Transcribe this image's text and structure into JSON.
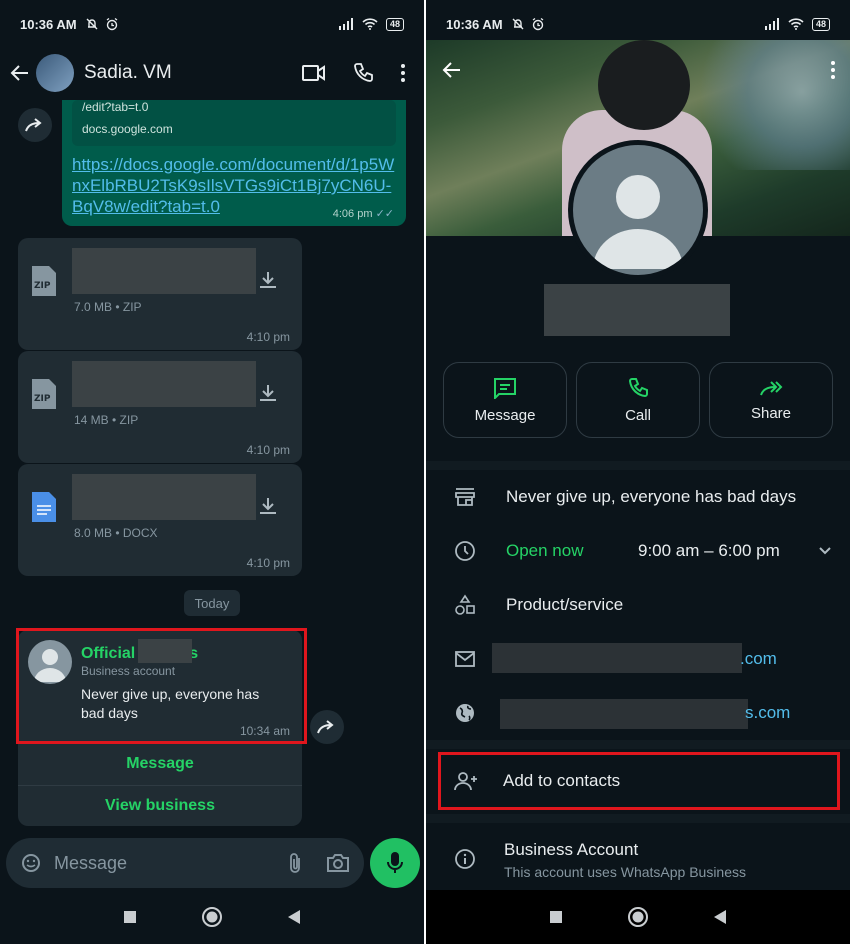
{
  "left": {
    "status": {
      "time": "10:36 AM",
      "battery": "48"
    },
    "header": {
      "back": "←",
      "name": "Sadia. VM"
    },
    "link_message": {
      "preview_line1": "/edit?tab=t.0",
      "preview_domain": "docs.google.com",
      "url": "https://docs.google.com/document/d/1p5WnxElbRBU2TsK9sIlsVTGs9iCt1Bj7yCN6U-BqV8w/edit?tab=t.0",
      "time": "4:06 pm",
      "ticks": "✓✓"
    },
    "files": [
      {
        "meta": "7.0 MB • ZIP",
        "time": "4:10 pm",
        "type_label": "ZIP"
      },
      {
        "meta": "14 MB • ZIP",
        "time": "4:10 pm",
        "type_label": "ZIP"
      },
      {
        "meta": "8.0 MB • DOCX",
        "time": "4:10 pm",
        "type_label": ""
      }
    ],
    "date_chip": "Today",
    "contact_card": {
      "name": "Official",
      "name_suffix": "s",
      "subtitle": "Business account",
      "about": "Never give up, everyone has bad days",
      "time": "10:34 am",
      "btn_message": "Message",
      "btn_view": "View business"
    },
    "input": {
      "placeholder": "Message"
    }
  },
  "right": {
    "status": {
      "time": "10:36 AM",
      "battery": "48"
    },
    "actions": {
      "message": "Message",
      "call": "Call",
      "share": "Share"
    },
    "about": "Never give up, everyone has bad days",
    "hours": {
      "status": "Open now",
      "range": "9:00 am – 6:00 pm"
    },
    "category": "Product/service",
    "email_suffix": ".com",
    "website_suffix": "s.com",
    "add_contact": "Add to contacts",
    "business_account": {
      "title": "Business Account",
      "subtitle": "This account uses WhatsApp Business"
    }
  },
  "colors": {
    "accent": "#25d366",
    "link": "#53bdeb",
    "highlight": "#e0161d",
    "bg": "#0b141a"
  }
}
